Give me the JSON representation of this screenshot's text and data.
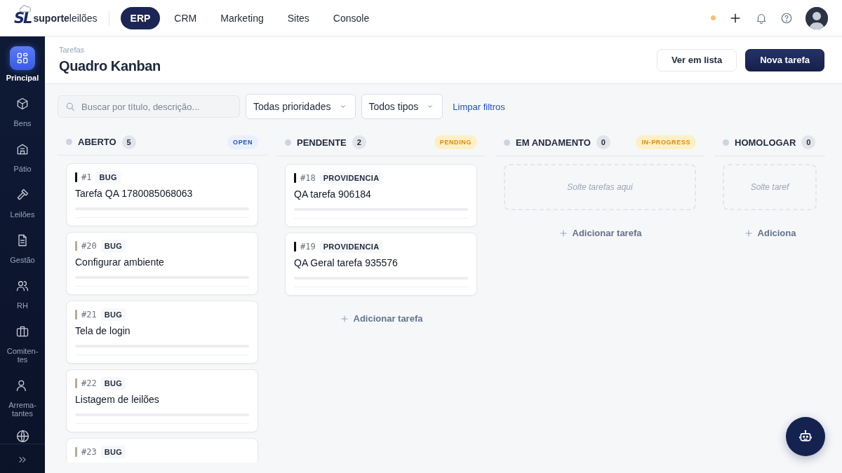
{
  "topbar": {
    "logo": {
      "mark": "SL",
      "name": "**suporte**leilões"
    },
    "nav": [
      {
        "label": "ERP",
        "selected": true
      },
      {
        "label": "CRM",
        "selected": false
      },
      {
        "label": "Marketing",
        "selected": false
      },
      {
        "label": "Sites",
        "selected": false
      },
      {
        "label": "Console",
        "selected": false
      }
    ]
  },
  "sidebar": {
    "items": [
      {
        "label": "Principal",
        "selected": true
      },
      {
        "label": "Bens",
        "selected": false
      },
      {
        "label": "Pátio",
        "selected": false
      },
      {
        "label": "Leilões",
        "selected": false
      },
      {
        "label": "Gestão",
        "selected": false
      },
      {
        "label": "RH",
        "selected": false
      },
      {
        "label": "Comiten-tes",
        "selected": false
      },
      {
        "label": "Arrema-tantes",
        "selected": false
      }
    ]
  },
  "header": {
    "breadcrumb": "Tarefas",
    "title": "Quadro Kanban",
    "buttons": [
      {
        "label": "Ver em lista",
        "kind": "secondary"
      },
      {
        "label": "Nova tarefa",
        "kind": "primary"
      }
    ]
  },
  "filters": {
    "search": {
      "placeholder": "Buscar por título, descrição..."
    },
    "selects": [
      "Todas prioridades",
      "Todos tipos"
    ],
    "clear": "Limpar filtros"
  },
  "columns": [
    {
      "title": "ABERTO",
      "count": "5",
      "status": "OPEN",
      "kind": "info",
      "cards": [
        {
          "number": "#1",
          "type": "BUG",
          "title": "Tarefa QA 1780085068063",
          "color": "#111111"
        },
        {
          "number": "#20",
          "type": "BUG",
          "title": "Configurar ambiente",
          "color": "#b9aa9a"
        },
        {
          "number": "#21",
          "type": "BUG",
          "title": "Tela de login",
          "color": "#b9aa9a"
        },
        {
          "number": "#22",
          "type": "BUG",
          "title": "Listagem de leilões",
          "color": "#b9aa9a"
        },
        {
          "number": "#23",
          "type": "BUG",
          "color": "#b9aa9a"
        }
      ]
    },
    {
      "title": "PENDENTE",
      "count": "2",
      "status": "PENDING",
      "kind": "warning",
      "add_label": "Adicionar tarefa",
      "cards": [
        {
          "number": "#18",
          "type": "PROVIDENCIA",
          "title": "QA tarefa 906184",
          "color": "#111111"
        },
        {
          "number": "#19",
          "type": "PROVIDENCIA",
          "title": "QA Geral tarefa 935576",
          "color": "#111111"
        }
      ]
    },
    {
      "title": "EM ANDAMENTO",
      "count": "0",
      "status": "IN-PROGRESS",
      "kind": "warning",
      "drop_hint": "Solte tarefas aqui",
      "add_label": "Adicionar tarefa"
    },
    {
      "title": "HOMOLOGAR",
      "count": "0",
      "drop_hint": "Solte taref",
      "add_label": "Adiciona"
    }
  ]
}
